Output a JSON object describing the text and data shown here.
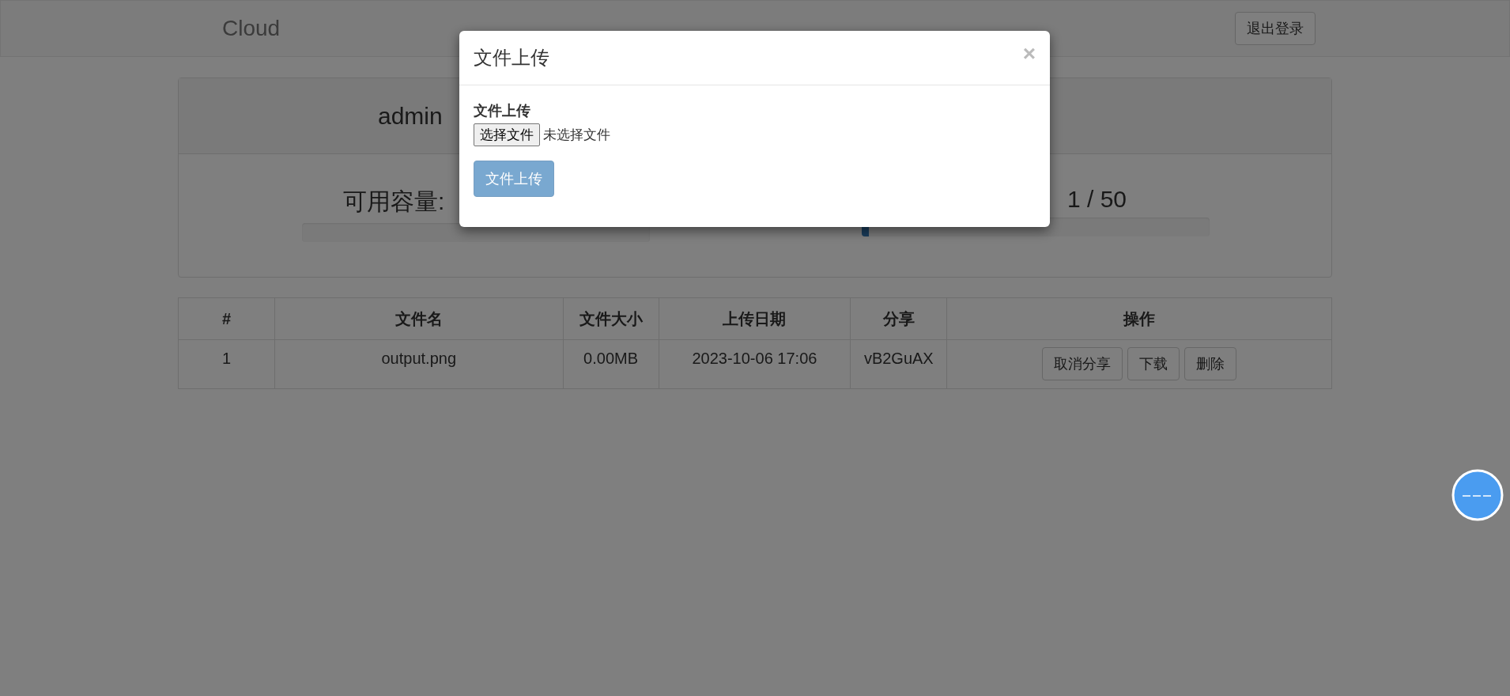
{
  "navbar": {
    "brand": "Cloud",
    "logout": "退出登录"
  },
  "profile": {
    "username": "admin",
    "capacity": {
      "label": "可用容量:"
    },
    "files": {
      "count": "1 / 50",
      "level": 0.02
    }
  },
  "table": {
    "columns": [
      "#",
      "文件名",
      "文件大小",
      "上传日期",
      "分享",
      "操作"
    ],
    "rows": [
      {
        "cells": [
          "1",
          "output.png",
          "0.00MB",
          "2023-10-06 17:06",
          "vB2GuAX"
        ],
        "actions": [
          "取消分享",
          "下载",
          "删除"
        ]
      }
    ]
  },
  "modal": {
    "title": "文件上传",
    "close": "×",
    "field_label": "文件上传",
    "choose_button": "选择文件",
    "no_file": "未选择文件",
    "submit": {
      "label": "文件上传",
      "disabled": true
    }
  }
}
